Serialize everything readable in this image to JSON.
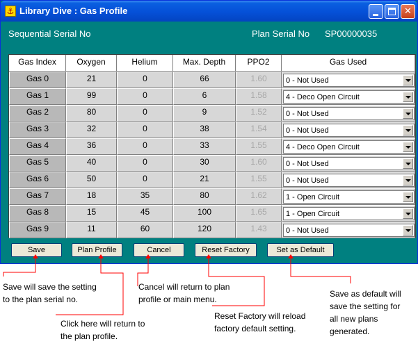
{
  "window": {
    "title": "Library Dive : Gas Profile",
    "icon": "dive-app-icon"
  },
  "header": {
    "serial_label": "Sequential Serial No",
    "plan_serial_label": "Plan Serial No",
    "plan_serial_value": "SP00000035"
  },
  "table": {
    "columns": [
      "Gas Index",
      "Oxygen",
      "Helium",
      "Max. Depth",
      "PPO2",
      "Gas Used"
    ],
    "rows": [
      {
        "gas": "Gas 0",
        "oxygen": "21",
        "helium": "0",
        "depth": "66",
        "ppo2": "1.60",
        "used": "0 - Not Used"
      },
      {
        "gas": "Gas 1",
        "oxygen": "99",
        "helium": "0",
        "depth": "6",
        "ppo2": "1.58",
        "used": "4 - Deco Open Circuit"
      },
      {
        "gas": "Gas 2",
        "oxygen": "80",
        "helium": "0",
        "depth": "9",
        "ppo2": "1.52",
        "used": "0 - Not Used"
      },
      {
        "gas": "Gas 3",
        "oxygen": "32",
        "helium": "0",
        "depth": "38",
        "ppo2": "1.54",
        "used": "0 - Not Used"
      },
      {
        "gas": "Gas 4",
        "oxygen": "36",
        "helium": "0",
        "depth": "33",
        "ppo2": "1.55",
        "used": "4 - Deco Open Circuit"
      },
      {
        "gas": "Gas 5",
        "oxygen": "40",
        "helium": "0",
        "depth": "30",
        "ppo2": "1.60",
        "used": "0 - Not Used"
      },
      {
        "gas": "Gas 6",
        "oxygen": "50",
        "helium": "0",
        "depth": "21",
        "ppo2": "1.55",
        "used": "0 - Not Used"
      },
      {
        "gas": "Gas 7",
        "oxygen": "18",
        "helium": "35",
        "depth": "80",
        "ppo2": "1.62",
        "used": "1 - Open Circuit"
      },
      {
        "gas": "Gas 8",
        "oxygen": "15",
        "helium": "45",
        "depth": "100",
        "ppo2": "1.65",
        "used": "1 - Open Circuit"
      },
      {
        "gas": "Gas 9",
        "oxygen": "11",
        "helium": "60",
        "depth": "120",
        "ppo2": "1.43",
        "used": "0 - Not Used"
      }
    ]
  },
  "buttons": {
    "save": "Save",
    "plan_profile": "Plan Profile",
    "cancel": "Cancel",
    "reset_factory": "Reset Factory",
    "set_default": "Set as Default"
  },
  "annotations": {
    "save": "Save will save the setting\nto the plan serial no.",
    "plan_profile": "Click here will return to\nthe plan profile.",
    "cancel": "Cancel will return to plan\nprofile or main menu.",
    "reset_factory": "Reset Factory will reload\nfactory default setting.",
    "set_default": "Save as default will\nsave the setting for\nall new plans\ngenerated."
  },
  "colors": {
    "window_bg": "#008080",
    "titlebar": "#0550d8",
    "callout_lines": "#ff0000",
    "ppo2_text": "#a8a8a8"
  }
}
